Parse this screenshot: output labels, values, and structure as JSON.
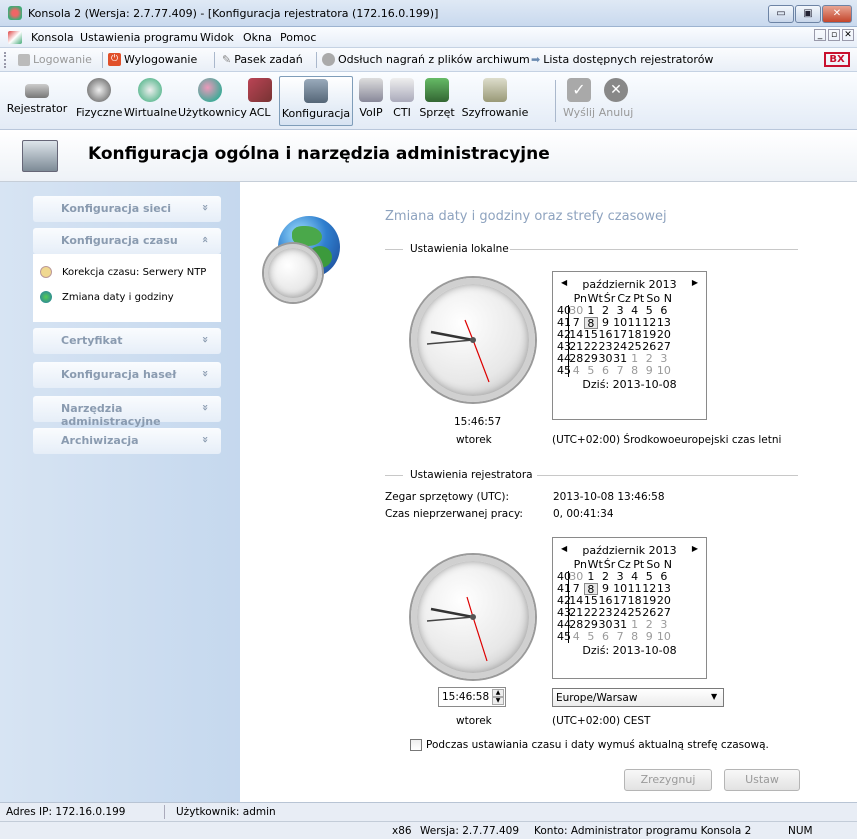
{
  "window": {
    "title": "Konsola 2 (Wersja:  2.7.77.409) - [Konfiguracja rejestratora (172.16.0.199)]",
    "min": "▭",
    "max": "▣",
    "close": "✕"
  },
  "menubar": {
    "items": [
      "Konsola",
      "Ustawienia programu",
      "Widok",
      "Okna",
      "Pomoc"
    ],
    "mdi_min": "_",
    "mdi_max": "▫",
    "mdi_close": "✕"
  },
  "toolbar1": {
    "login": "Logowanie",
    "logout": "Wylogowanie",
    "taskbar": "Pasek zadań",
    "playback": "Odsłuch nagrań z plików archiwum",
    "recorders": "Lista dostępnych rejestratorów",
    "brand": "BX"
  },
  "toolbar2": {
    "buttons": [
      "Rejestrator",
      "Fizyczne",
      "Wirtualne",
      "Użytkownicy",
      "ACL",
      "Konfiguracja",
      "VoIP",
      "CTI",
      "Sprzęt",
      "Szyfrowanie",
      "Wyślij",
      "Anuluj"
    ]
  },
  "header": {
    "title": "Konfiguracja ogólna i narzędzia administracyjne"
  },
  "sidebar": {
    "sections": [
      "Konfiguracja sieci",
      "Konfiguracja czasu",
      "Certyfikat",
      "Konfiguracja haseł",
      "Narzędzia administracyjne",
      "Archiwizacja"
    ],
    "items": [
      "Korekcja czasu: Serwery NTP",
      "Zmiana daty i godziny"
    ],
    "chev_down": "»",
    "chev_up": "«"
  },
  "main": {
    "heading": "Zmiana daty i godziny oraz strefy czasowej",
    "local": {
      "section": "Ustawienia lokalne",
      "time": "15:46:57",
      "day": "wtorek",
      "tz": "(UTC+02:00) Środkowoeuropejski czas letni"
    },
    "recorder": {
      "section": "Ustawienia rejestratora",
      "hw_label": "Zegar sprzętowy (UTC):",
      "hw_value": "2013-10-08 13:46:58",
      "uptime_label": "Czas nieprzerwanej pracy:",
      "uptime_value": "0, 00:41:34",
      "time": "15:46:58",
      "day": "wtorek",
      "tz_select": "Europe/Warsaw",
      "tz": "(UTC+02:00) CEST"
    },
    "checkbox": "Podczas ustawiania czasu i daty wymuś aktualną strefę czasową.",
    "cancel": "Zrezygnuj",
    "apply": "Ustaw"
  },
  "calendar": {
    "month": "październik 2013",
    "today": "Dziś: 2013-10-08",
    "days": [
      "Pn",
      "Wt",
      "Śr",
      "Cz",
      "Pt",
      "So",
      "N"
    ],
    "rows": [
      {
        "wk": "40",
        "d": [
          "30",
          "1",
          "2",
          "3",
          "4",
          "5",
          "6"
        ]
      },
      {
        "wk": "41",
        "d": [
          "7",
          "8",
          "9",
          "10",
          "11",
          "12",
          "13"
        ]
      },
      {
        "wk": "42",
        "d": [
          "14",
          "15",
          "16",
          "17",
          "18",
          "19",
          "20"
        ]
      },
      {
        "wk": "43",
        "d": [
          "21",
          "22",
          "23",
          "24",
          "25",
          "26",
          "27"
        ]
      },
      {
        "wk": "44",
        "d": [
          "28",
          "29",
          "30",
          "31",
          "1",
          "2",
          "3"
        ]
      },
      {
        "wk": "45",
        "d": [
          "4",
          "5",
          "6",
          "7",
          "8",
          "9",
          "10"
        ]
      }
    ]
  },
  "status": {
    "ip": "Adres IP: 172.16.0.199",
    "user": "Użytkownik: admin",
    "arch": "x86",
    "version": "Wersja: 2.7.77.409",
    "account": "Konto: Administrator programu Konsola 2",
    "num": "NUM"
  },
  "colors": {
    "accent": "#8a9fbd",
    "sidebar": "#c9dbef",
    "heading": "#8ea3bf"
  }
}
